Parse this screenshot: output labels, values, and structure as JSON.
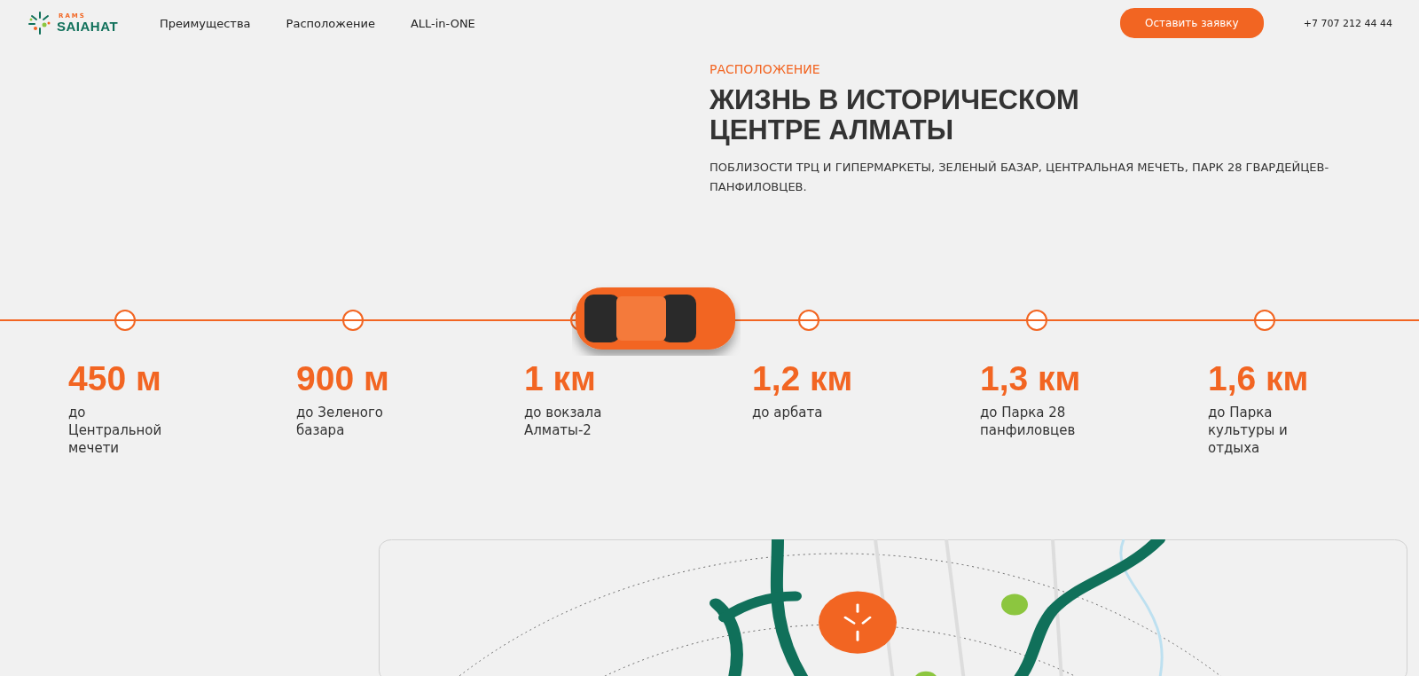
{
  "header": {
    "logo": {
      "small": "RAMS",
      "name": "SAIAHAT"
    },
    "nav": [
      "Преимущества",
      "Расположение",
      "ALL-in-ONE"
    ],
    "cta": "Оставить заявку",
    "phone": "+7 707 212 44 44"
  },
  "location": {
    "eyebrow": "РАСПОЛОЖЕНИЕ",
    "title_lines": [
      "ЖИЗНЬ В ИСТОРИЧЕСКОМ",
      "ЦЕНТРЕ АЛМАТЫ"
    ],
    "subtitle": "ПОБЛИЗОСТИ ТРЦ И ГИПЕРМАРКЕТЫ, ЗЕЛЕНЫЙ БАЗАР, ЦЕНТРАЛЬНАЯ МЕЧЕТЬ, ПАРК 28 ГВАРДЕЙЦЕВ-ПАНФИЛОВЦЕВ."
  },
  "distances": [
    {
      "value": "450 м",
      "label": "до Центральной мечети"
    },
    {
      "value": "900 м",
      "label": "до Зеленого базара"
    },
    {
      "value": "1 км",
      "label": "до вокзала Алматы-2"
    },
    {
      "value": "1,2 км",
      "label": "до арбата"
    },
    {
      "value": "1,3 км",
      "label": "до Парка 28 панфиловцев"
    },
    {
      "value": "1,6 км",
      "label": "до Парка культуры и отдыха"
    }
  ]
}
